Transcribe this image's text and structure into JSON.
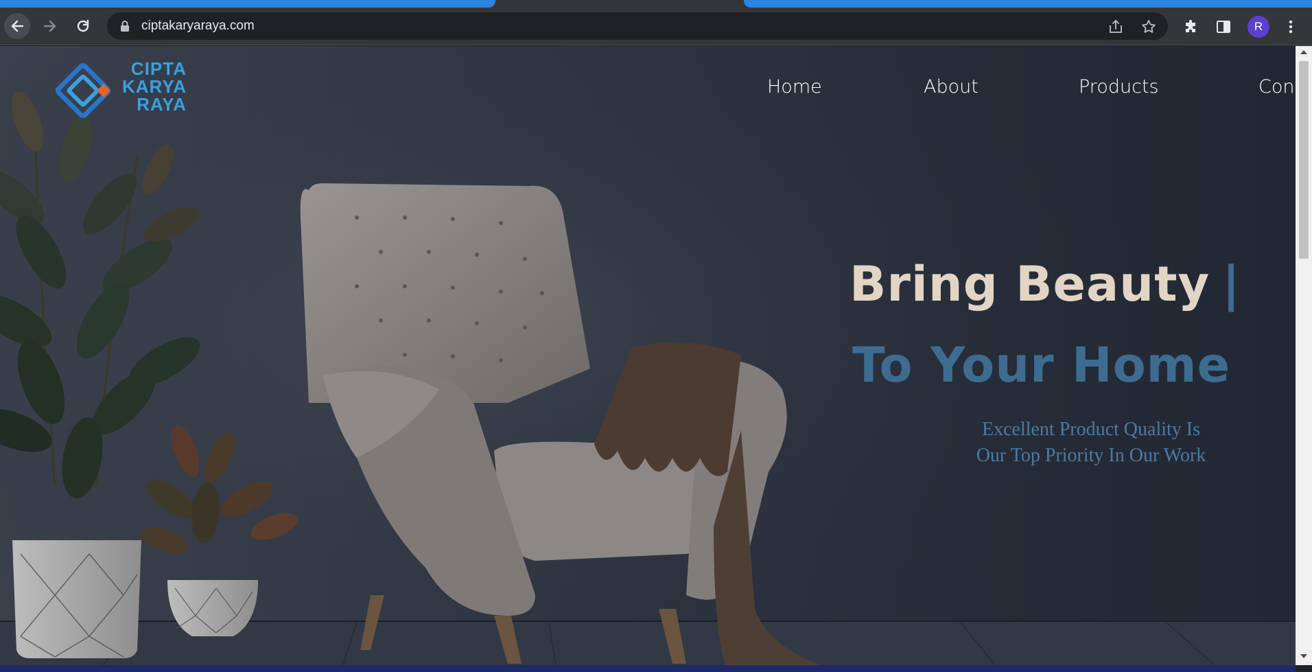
{
  "browser": {
    "url": "ciptakaryaraya.com",
    "profile_initial": "R",
    "icons": {
      "back": "arrow-left-icon",
      "forward": "arrow-right-icon",
      "reload": "reload-icon",
      "lock": "lock-icon",
      "share": "share-icon",
      "bookmark": "star-icon",
      "extensions": "puzzle-icon",
      "side_panel": "side-panel-icon",
      "menu": "kebab-menu-icon"
    }
  },
  "site": {
    "logo": {
      "line1": "CIPTA",
      "line2": "KARYA",
      "line3": "RAYA"
    },
    "nav": {
      "home": "Home",
      "about": "About",
      "products": "Products",
      "contact": "Contact"
    },
    "hero": {
      "title_line1": "Bring Beauty",
      "cursor": "|",
      "title_line2": "To Your Home",
      "subtitle_line1": "Excellent Product Quality Is",
      "subtitle_line2": "Our Top Priority In Our Work"
    }
  },
  "colors": {
    "tab_accent": "#2b86e0",
    "logo_blue": "#3b9fe0",
    "logo_orange": "#e8622c",
    "hero_beige": "#e2d5c6",
    "hero_blue": "#3e6c91",
    "subtitle_blue": "#4c7aa3"
  }
}
